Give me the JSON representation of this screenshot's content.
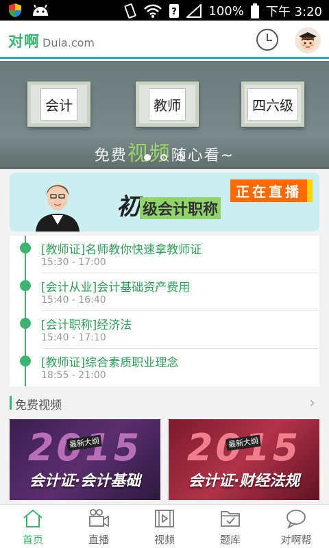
{
  "status_bar": {
    "battery": "100%",
    "time": "下午 3:20",
    "icons": [
      "shield-icon",
      "android-icon",
      "vibrate-icon",
      "wifi-icon",
      "notification-icon",
      "signal-icon",
      "battery-icon"
    ]
  },
  "header": {
    "logo_cn": "对啊",
    "logo_en": "Duia.com",
    "history_icon": "clock-icon",
    "avatar_icon": "graduate-avatar-icon"
  },
  "banner": {
    "categories": [
      "会计",
      "教师",
      "四六级"
    ],
    "slogan_pre": "免费",
    "slogan_highlight": "视频",
    "slogan_post": "随心看~",
    "active_slide": 1,
    "total_slides": 3
  },
  "live_banner": {
    "title_big": "初",
    "title_rest": "级会计职称",
    "badge": "正在直播"
  },
  "schedule": [
    {
      "title": "[教师证]名师教你快速拿教师证",
      "time": "15:30 - 17:00"
    },
    {
      "title": "[会计从业]会计基础资产费用",
      "time": "15:40 - 16:40"
    },
    {
      "title": "[会计职称]经济法",
      "time": "15:40 - 17:10"
    },
    {
      "title": "[教师证]综合素质职业理念",
      "time": "18:55 - 21:00"
    }
  ],
  "free_videos": {
    "heading": "免费视频",
    "more_icon": "chevron-right-icon",
    "cards": [
      {
        "year": "2015",
        "tag": "最新大纲",
        "course": "会计证·会计基础"
      },
      {
        "year": "2015",
        "tag": "最新大纲",
        "course": "会计证·财经法规"
      }
    ]
  },
  "tabs": [
    {
      "label": "首页",
      "icon": "home-icon",
      "active": true
    },
    {
      "label": "直播",
      "icon": "video-camera-icon",
      "active": false
    },
    {
      "label": "视频",
      "icon": "film-icon",
      "active": false
    },
    {
      "label": "题库",
      "icon": "folder-check-icon",
      "active": false
    },
    {
      "label": "对啊帮",
      "icon": "chat-bubble-icon",
      "active": false
    }
  ],
  "colors": {
    "brand_green": "#3cb371",
    "header_underline": "#2ea7c8",
    "live_badge": "#ff6a00"
  }
}
